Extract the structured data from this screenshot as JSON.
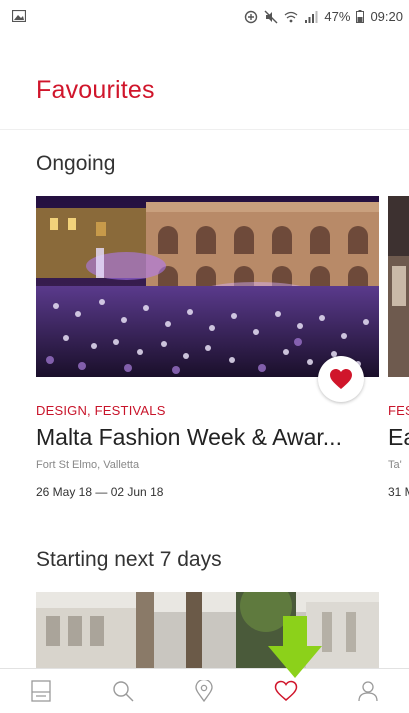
{
  "status_bar": {
    "battery": "47%",
    "time": "09:20"
  },
  "header": {
    "title": "Favourites"
  },
  "sections": [
    {
      "title": "Ongoing",
      "cards": [
        {
          "category": "DESIGN, FESTIVALS",
          "name": "Malta Fashion Week & Awar...",
          "venue": "Fort St Elmo, Valletta",
          "dates": "26 May 18 — 02 Jun 18",
          "favourited": true
        },
        {
          "category": "FES",
          "name": "Ea",
          "venue": "Ta'",
          "dates": "31 M"
        }
      ]
    },
    {
      "title": "Starting next 7 days"
    }
  ],
  "bottom_nav": [
    {
      "icon": "listings-icon",
      "active": false
    },
    {
      "icon": "search-icon",
      "active": false
    },
    {
      "icon": "map-pin-icon",
      "active": false
    },
    {
      "icon": "heart-icon",
      "active": true
    },
    {
      "icon": "profile-icon",
      "active": false
    }
  ],
  "colors": {
    "accent": "#d0152b",
    "arrow": "#8cd11a",
    "nav_inactive": "#9a9a9a"
  }
}
